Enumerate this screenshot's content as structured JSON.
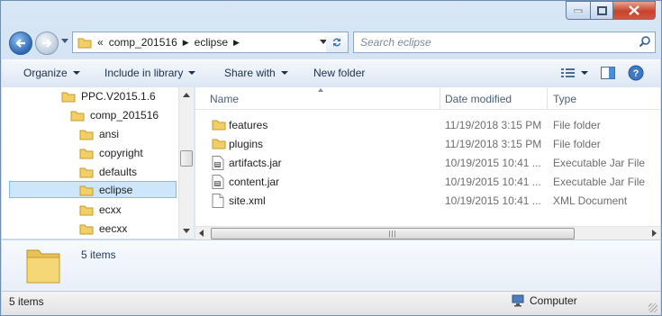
{
  "window": {
    "controls": [
      "minimize",
      "maximize",
      "close"
    ]
  },
  "address_bar": {
    "overflow": "«",
    "crumbs": [
      "comp_201516",
      "eclipse"
    ],
    "search_placeholder": "Search eclipse"
  },
  "toolbar": {
    "organize": "Organize",
    "include_in_library": "Include in library",
    "share_with": "Share with",
    "new_folder": "New folder"
  },
  "tree": {
    "items": [
      {
        "label": "PPC.V2015.1.6"
      },
      {
        "label": "comp_201516"
      },
      {
        "label": "ansi"
      },
      {
        "label": "copyright"
      },
      {
        "label": "defaults"
      },
      {
        "label": "eclipse",
        "selected": true
      },
      {
        "label": "ecxx"
      },
      {
        "label": "eecxx"
      }
    ]
  },
  "columns": {
    "name": "Name",
    "date_modified": "Date modified",
    "type": "Type"
  },
  "files": [
    {
      "name": "features",
      "date": "11/19/2018 3:15 PM",
      "type": "File folder",
      "icon": "folder-icon"
    },
    {
      "name": "plugins",
      "date": "11/19/2018 3:15 PM",
      "type": "File folder",
      "icon": "folder-icon"
    },
    {
      "name": "artifacts.jar",
      "date": "10/19/2015 10:41 ...",
      "type": "Executable Jar File",
      "icon": "jar-file-icon"
    },
    {
      "name": "content.jar",
      "date": "10/19/2015 10:41 ...",
      "type": "Executable Jar File",
      "icon": "jar-file-icon"
    },
    {
      "name": "site.xml",
      "date": "10/19/2015 10:41 ...",
      "type": "XML Document",
      "icon": "xml-file-icon"
    }
  ],
  "details": {
    "count": "5 items"
  },
  "status": {
    "count": "5 items",
    "location": "Computer"
  }
}
